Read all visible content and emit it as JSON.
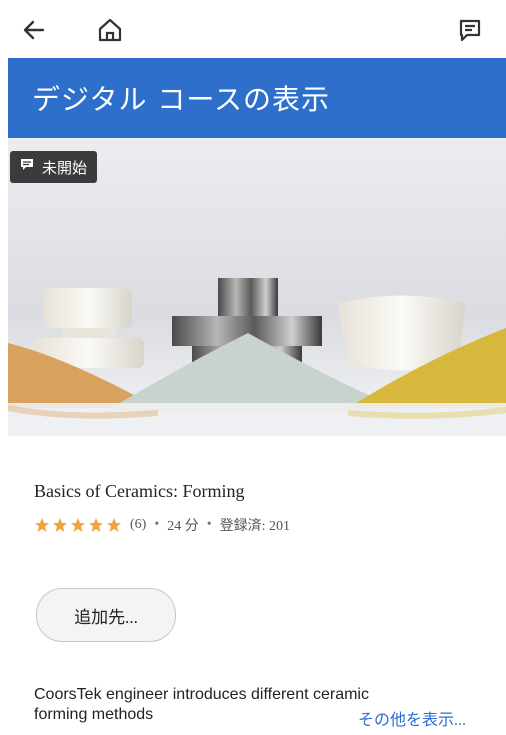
{
  "nav": {
    "back_icon": "back-arrow-icon",
    "home_icon": "home-icon",
    "notes_icon": "notes-icon"
  },
  "banner": {
    "title": "デジタル コースの表示",
    "color": "#2f6fcc"
  },
  "hero": {
    "status_badge": "未開始",
    "status_icon": "comment-icon"
  },
  "course": {
    "title": "Basics of Ceramics: Forming",
    "rating_stars": 5,
    "rating_count": "(6)",
    "duration": "24 分",
    "enrolled": "登録済: 201",
    "star_color": "#f2a33a"
  },
  "actions": {
    "add_to_label": "追加先..."
  },
  "description": {
    "line1": "CoorsTek engineer introduces different ceramic",
    "line2": "forming methods",
    "more_label": "その他を表示..."
  }
}
